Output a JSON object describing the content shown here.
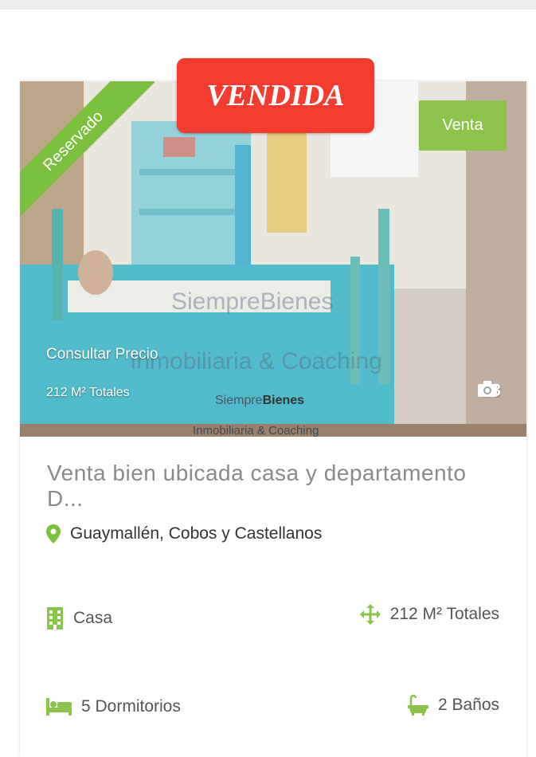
{
  "badges": {
    "sold": "VENDIDA",
    "reserved": "Reservado",
    "operation": "Venta"
  },
  "listing": {
    "price": "Consultar Precio",
    "area_overlay": "212 M² Totales",
    "photo_count": "13",
    "title": "Venta bien ubicada casa y departamento D...",
    "location": "Guaymallén, Cobos y Castellanos"
  },
  "features": {
    "type": "Casa",
    "area": "212 M² Totales",
    "bedrooms": "5 Dormitorios",
    "bathrooms": "2 Baños"
  },
  "watermark": {
    "brand_light": "Siempre",
    "brand_bold": "Bienes",
    "tagline": "Inmobiliaria & Coaching",
    "big_line1": "SiempreBienes",
    "big_line2": "Inmobiliaria & Coaching"
  },
  "icons": [
    "camera-icon",
    "map-pin-icon",
    "building-icon",
    "move-arrows-icon",
    "bed-icon",
    "bathtub-icon"
  ],
  "colors": {
    "accent_green": "#8cc44b",
    "sold_red": "#f23c2f",
    "title_gray": "#8a8a8a"
  }
}
